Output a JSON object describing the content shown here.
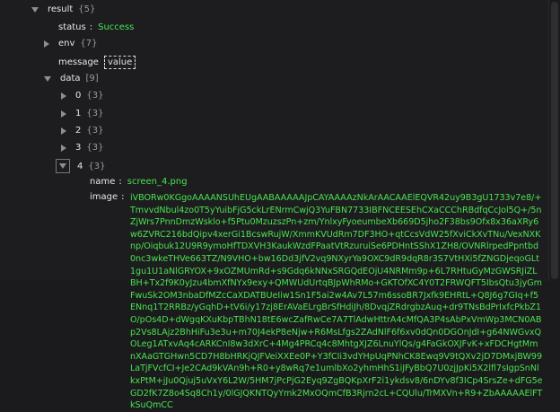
{
  "tree": {
    "result": {
      "key": "result",
      "count": "{5}"
    },
    "status": {
      "key": "status",
      "value": "Success"
    },
    "env": {
      "key": "env",
      "count": "{7}"
    },
    "message": {
      "key": "message",
      "value": "value"
    },
    "data": {
      "key": "data",
      "count": "[9]"
    },
    "items": [
      {
        "index": "0",
        "count": "{3}"
      },
      {
        "index": "1",
        "count": "{3}"
      },
      {
        "index": "2",
        "count": "{3}"
      },
      {
        "index": "3",
        "count": "{3}"
      },
      {
        "index": "4",
        "count": "{3}"
      }
    ],
    "name": {
      "key": "name",
      "value": "screen_4.png"
    },
    "image": {
      "key": "image",
      "value": "iVBORw0KGgoAAAANSUhEUgAABAAAAAJpCAYAAAAzNkArAACAAElEQVR42uy9B3gU1733v7e8/+TmvvdNbul4zo0T5yYuibFjG5ckLrENrmCwjQ3YuFBN7733IBFNCEESEhCXaCCChRBdfqCcJol5Q+/5nZjWrs7PnnDmzWsklo+f5Ptu0MzuzszPn+zm/YnlxyFyoeumbeXb669D5jho2F38bs9Ofx8x36aXRy6w6ZVRC216bdQipv4xerGi1BcswRujW/XmmKVUdRm7DF3HO+qtCcsVdW25fXviCkXvTNu/VexNXKnp/Oiqbuk12U9R9ymoHfTDXVH3KaukWzdFPaatVtRzuruiSe6PDHntSShX1ZH8/OVNRlrpedPpntbd0nc3wkeTHVe663TZ/N9VHO+bw16Dd3jfV2vq9NXyrYa9OXC9dR9dqR8r3S7VtHXi5fZNGDjeqoGLt1gu1U1aNlGRYOX+9xOZMUmRd+s9Gdq6kNNxSRGQdEOjU4NRMm9p+6L7RHtuGyMzGWSRJiZLBH+Tx2f9K0yJzu4bmXfNYx9exy+QMWUdUrtqBJpWhRMo+GKTOfXC4Y0T2FRWQFT5IbsQtu3jyGmFwuSk2OM3nbaDfMZcCaXDATBUeIiw1Sn1F5ai2w4Av7L57m6ssoBR7Jxfk9EHRtL+Q8J6g7GIq+f5ENnq1T2RRBz/yGqhD+tV6i/y17zj8ErAVaELrgBrSfHdiJh/8DvqjZRdrgbzAuq+dr9TNsBdPrIxfcPkbZ1O/pOs4D+dWgqKXuKbpTBhN18tE6wcZafRwCe7A7TlAdwHttrA4cMfQA3P4sAbPxVmWp3MCN0ABp2Vs8LAjz2BhHiFu3e3u+m70J4ekP8eNjw+R6MsLfgs2ZAdNlF6f6xv0dQn0DGOnJdI+g64NWGvxQOLeg1ATxvAq4cARKCnI8w3dXrC+4Mg4PRCq4c8MhtgXJZ6LnuYlQs/g4FaGkOXJFvK+xFDCHgtMmnXAaGTGHwn5CD7H8bHRKjQJFVeiXXEe0P+Y3fCIi3vdYHpUqPNhCK8Ewq9V9tQXv2jD7DMxjBW99LaTjFVcfCI+Je2CAd9kVAn9h+R0+y8wRq7e1umlbXo2yhmHhS1iJFyBbQ7U0zjJpKi5X2lfl7sIgpSnNlkxPtM+jJu0Qjuj5uVxY6L2W/5HM7jPcPjG2Eyq9ZgBQKpXrF2i1ykdsv8/6nDYv8f3ICp4SrsZe+dFG5eGD2fK7Z8o4Sq8Ch1y/0lGJQKNTQyYmk2MxOQmCfB3Rjrn2cL+CQUlu/TrMXVn+R9+ZbAAAAAElFTkSuQmCC"
    }
  }
}
